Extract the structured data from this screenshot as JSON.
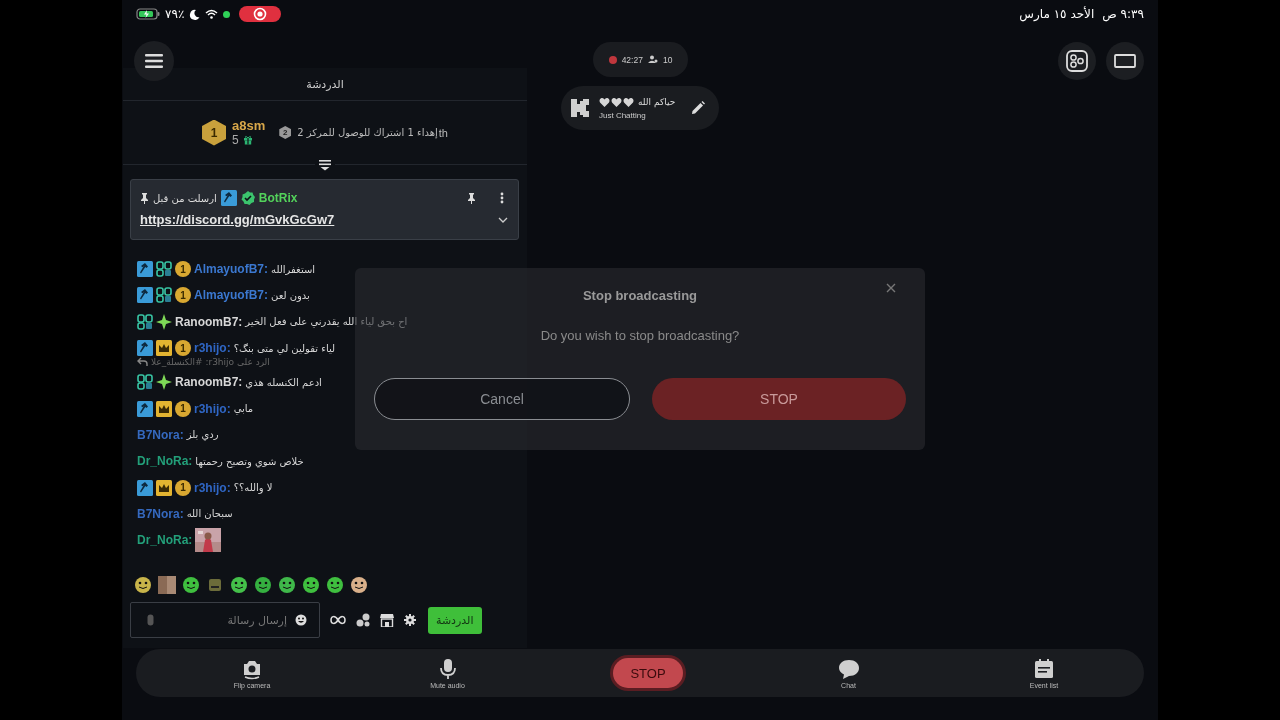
{
  "status_bar": {
    "battery": "٪٧٩",
    "time": "٩:٣٩ ص",
    "date": "الأحد ١٥ مارس"
  },
  "stream": {
    "duration": "42:27",
    "viewers": "10",
    "title": "حياكم الله",
    "category": "Just Chatting"
  },
  "chat": {
    "title": "الدردشة",
    "gift_leader": {
      "rank": "1",
      "user": "a8sm",
      "gifts": "5",
      "next_rank": "2",
      "text": "إهداء 1 اشتراك للوصول للمركز 2",
      "suffix": "th"
    },
    "pinned": {
      "label": "ارسلت من قبل",
      "user": "BotRix",
      "link": "https://discord.gg/mGvkGcGw7"
    },
    "messages": [
      {
        "kind": "message",
        "badges": [
          {
            "kind": "mod"
          },
          {
            "kind": "og"
          },
          {
            "kind": "sub",
            "text": "1"
          }
        ],
        "user": "AlmayuofB7:",
        "color": "#3b78d0",
        "text": "استغفرالله"
      },
      {
        "kind": "message",
        "badges": [
          {
            "kind": "mod"
          },
          {
            "kind": "og"
          },
          {
            "kind": "sub",
            "text": "1"
          }
        ],
        "user": "AlmayuofB7:",
        "color": "#3b78d0",
        "text": "بدون لعن"
      },
      {
        "kind": "message",
        "badges": [
          {
            "kind": "og"
          },
          {
            "kind": "gem"
          }
        ],
        "user": "RanoomB7:",
        "color": "#d8d8d8",
        "text": "اح بحق لياء الله يقدرني على فعل الخير"
      },
      {
        "kind": "message",
        "badges": [
          {
            "kind": "mod"
          },
          {
            "kind": "crown"
          },
          {
            "kind": "sub",
            "text": "1"
          }
        ],
        "user": "r3hijo:",
        "color": "#2f66c4",
        "text": "لياء تقولين لي متى بنگ؟"
      },
      {
        "kind": "reply",
        "text": "الرد على r3hijo: #الكنسلة_علا"
      },
      {
        "kind": "message",
        "badges": [
          {
            "kind": "og"
          },
          {
            "kind": "gem"
          }
        ],
        "user": "RanoomB7:",
        "color": "#d8d8d8",
        "text": "ادعم الكنسله هذي"
      },
      {
        "kind": "message",
        "badges": [
          {
            "kind": "mod"
          },
          {
            "kind": "crown"
          },
          {
            "kind": "sub",
            "text": "1"
          }
        ],
        "user": "r3hijo:",
        "color": "#2f66c4",
        "text": "مابي"
      },
      {
        "kind": "message",
        "user": "B7Nora:",
        "color": "#3569bf",
        "text": "ردي بلز"
      },
      {
        "kind": "message",
        "user": "Dr_NoRa:",
        "color": "#23a07a",
        "text": "خلاص شوي وتصبح رحمتها"
      },
      {
        "kind": "message",
        "badges": [
          {
            "kind": "mod"
          },
          {
            "kind": "crown"
          },
          {
            "kind": "sub",
            "text": "1"
          }
        ],
        "user": "r3hijo:",
        "color": "#2f66c4",
        "text": "لا والله؟؟"
      },
      {
        "kind": "message",
        "user": "B7Nora:",
        "color": "#3569bf",
        "text": "سبحان الله"
      },
      {
        "kind": "emote",
        "user": "Dr_NoRa:",
        "color": "#23a07a"
      }
    ],
    "input": {
      "placeholder": "إرسال رسالة"
    },
    "send_button": "الدردشة"
  },
  "dialog": {
    "title": "Stop broadcasting",
    "message": "Do you wish to stop broadcasting?",
    "buttons": [
      {
        "kind": "danger",
        "label": "STOP"
      },
      {
        "kind": "secondary",
        "label": "Cancel"
      }
    ]
  },
  "bottom_bar": [
    {
      "kind": "list",
      "label": "Event list"
    },
    {
      "kind": "chat",
      "label": "Chat"
    },
    {
      "kind": "stop",
      "label": "STOP"
    },
    {
      "kind": "mic",
      "label": "Mute audio"
    },
    {
      "kind": "camera",
      "label": "Flip camera"
    }
  ]
}
